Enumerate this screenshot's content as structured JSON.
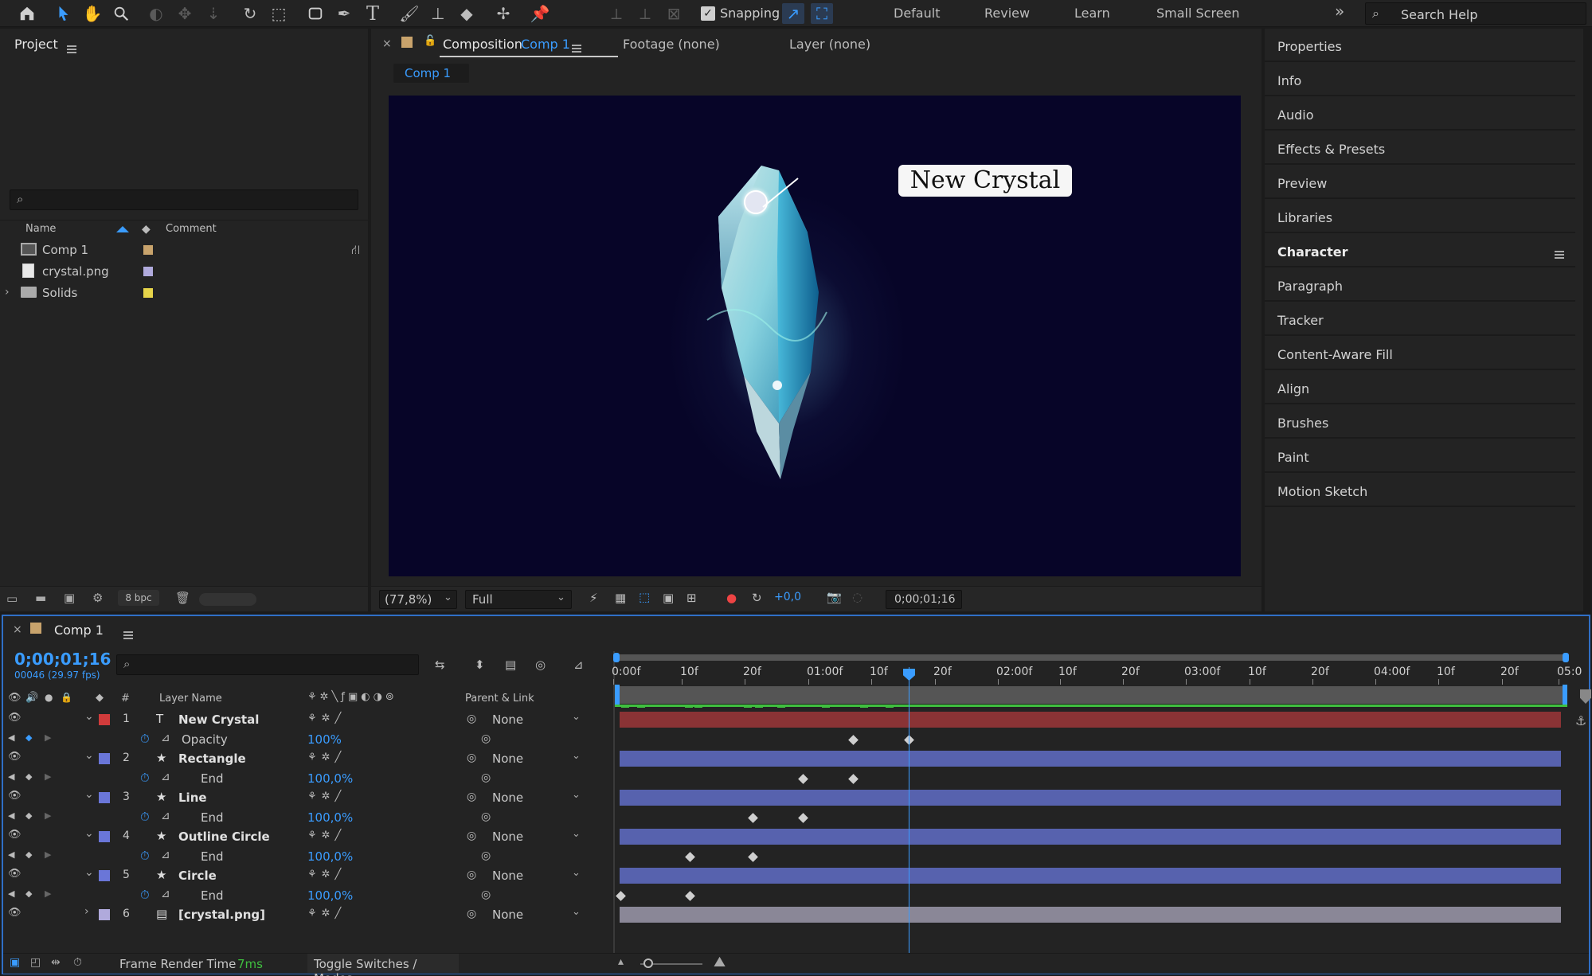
{
  "toolbar": {
    "snapping_label": "Snapping",
    "workspaces": [
      "Default",
      "Review",
      "Learn",
      "Small Screen"
    ],
    "more": "»",
    "search_placeholder": "Search Help"
  },
  "project": {
    "title": "Project",
    "columns": {
      "name": "Name",
      "comment": "Comment"
    },
    "items": [
      {
        "name": "Comp 1",
        "icon": "composition-icon",
        "color": "#c8a36c"
      },
      {
        "name": "crystal.png",
        "icon": "file-icon",
        "color": "#b0aadc"
      },
      {
        "name": "Solids",
        "icon": "folder-icon",
        "color": "#e6d44a"
      }
    ],
    "bpc": "8 bpc"
  },
  "composition": {
    "tab_label": "Composition",
    "tab_comp": "Comp 1",
    "footage_tab": "Footage (none)",
    "layer_tab": "Layer (none)",
    "subtab": "Comp 1",
    "callout_text": "New Crystal",
    "zoom": "(77,8%)",
    "resolution": "Full",
    "exposure": "+0,0",
    "timecode": "0;00;01;16"
  },
  "side_panels": [
    "Properties",
    "Info",
    "Audio",
    "Effects & Presets",
    "Preview",
    "Libraries",
    "Character",
    "Paragraph",
    "Tracker",
    "Content-Aware Fill",
    "Align",
    "Brushes",
    "Paint",
    "Motion Sketch"
  ],
  "timeline": {
    "comp_name": "Comp 1",
    "timecode": "0;00;01;16",
    "frame_info": "00046 (29.97 fps)",
    "col_number": "#",
    "col_layer_name": "Layer Name",
    "col_parent": "Parent & Link",
    "ruler": [
      "0:00f",
      "10f",
      "20f",
      "01:00f",
      "10f",
      "20f",
      "02:00f",
      "10f",
      "20f",
      "03:00f",
      "10f",
      "20f",
      "04:00f",
      "10f",
      "20f",
      "05:0"
    ],
    "layers": [
      {
        "num": "1",
        "name": "New Crystal",
        "type_icon": "T",
        "color": "#d13b3b",
        "prop": "Opacity",
        "value": "100%",
        "parent": "None",
        "bar": "#8a3335"
      },
      {
        "num": "2",
        "name": "Rectangle",
        "type_icon": "★",
        "color": "#6a76d8",
        "prop": "End",
        "value": "100,0%",
        "parent": "None",
        "bar": "#5762ae"
      },
      {
        "num": "3",
        "name": "Line",
        "type_icon": "★",
        "color": "#6a76d8",
        "prop": "End",
        "value": "100,0%",
        "parent": "None",
        "bar": "#5762ae"
      },
      {
        "num": "4",
        "name": "Outline Circle",
        "type_icon": "★",
        "color": "#6a76d8",
        "prop": "End",
        "value": "100,0%",
        "parent": "None",
        "bar": "#5762ae"
      },
      {
        "num": "5",
        "name": "Circle",
        "type_icon": "★",
        "color": "#6a76d8",
        "prop": "End",
        "value": "100,0%",
        "parent": "None",
        "bar": "#5762ae"
      },
      {
        "num": "6",
        "name": "[crystal.png]",
        "type_icon": "▤",
        "color": "#b0aadc",
        "parent": "None",
        "bar": "#8a8797"
      }
    ],
    "frame_render_label": "Frame Render Time",
    "frame_render_value": "7ms",
    "toggle_label": "Toggle Switches / Modes"
  }
}
